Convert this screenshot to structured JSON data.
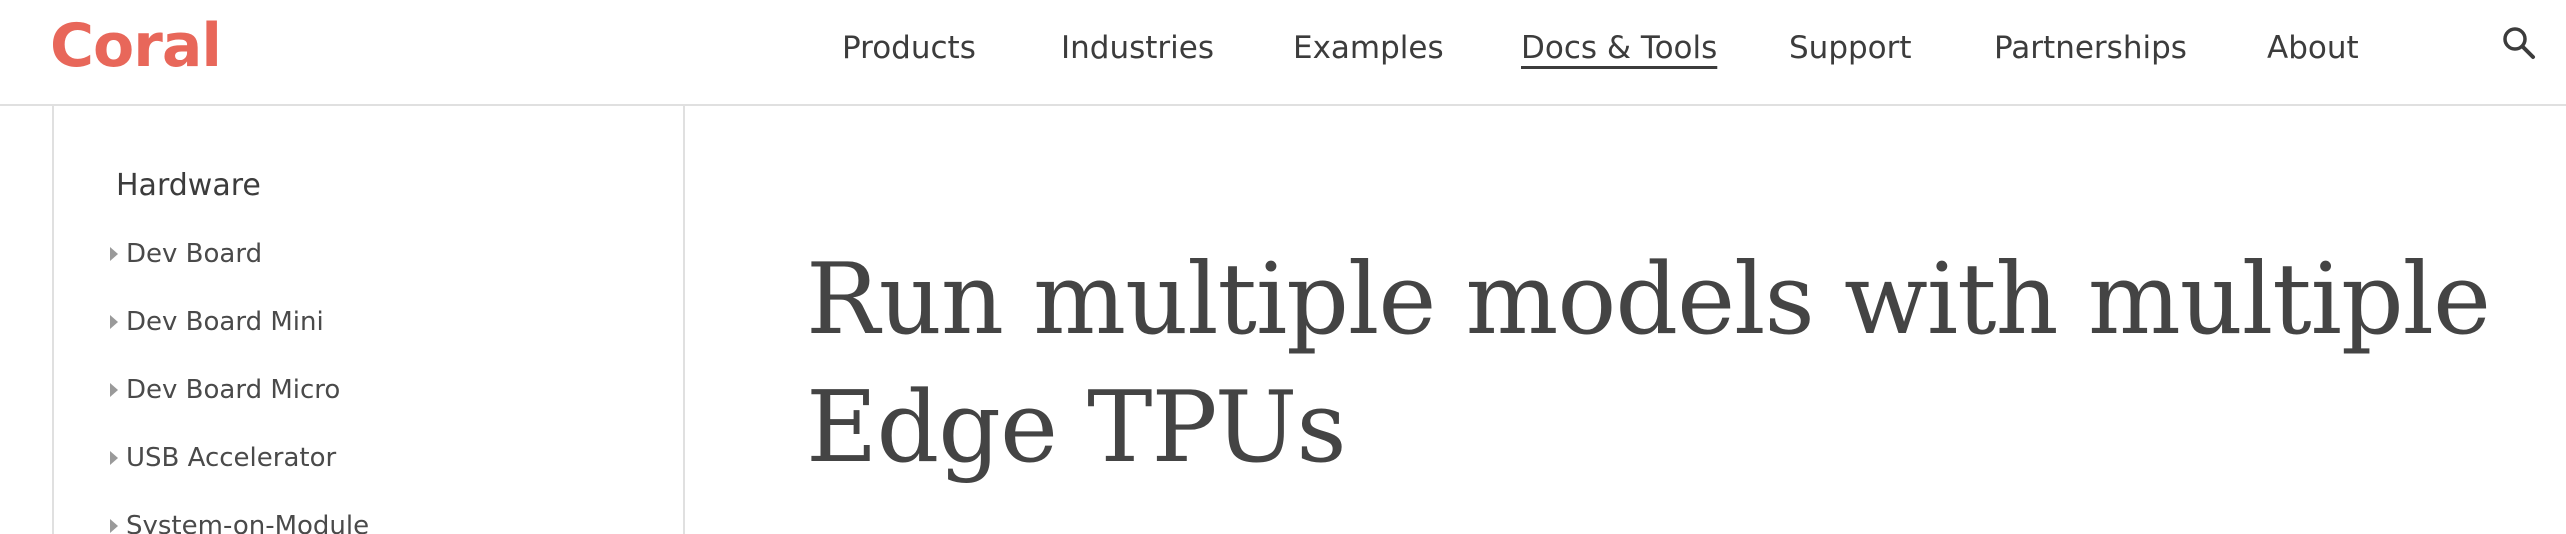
{
  "header": {
    "logo": "Coral",
    "nav": [
      {
        "label": "Products",
        "active": false
      },
      {
        "label": "Industries",
        "active": false
      },
      {
        "label": "Examples",
        "active": false
      },
      {
        "label": "Docs & Tools",
        "active": true
      },
      {
        "label": "Support",
        "active": false
      },
      {
        "label": "Partnerships",
        "active": false
      },
      {
        "label": "About",
        "active": false
      }
    ],
    "search_icon": "search-icon"
  },
  "sidebar": {
    "heading": "Hardware",
    "items": [
      {
        "label": "Dev Board"
      },
      {
        "label": "Dev Board Mini"
      },
      {
        "label": "Dev Board Micro"
      },
      {
        "label": "USB Accelerator"
      },
      {
        "label": "System-on-Module"
      }
    ]
  },
  "main": {
    "title": "Run multiple models with multiple Edge TPUs"
  },
  "colors": {
    "brand": "#e8675a",
    "text": "#3c3c3c",
    "border": "#e0e0e0"
  }
}
